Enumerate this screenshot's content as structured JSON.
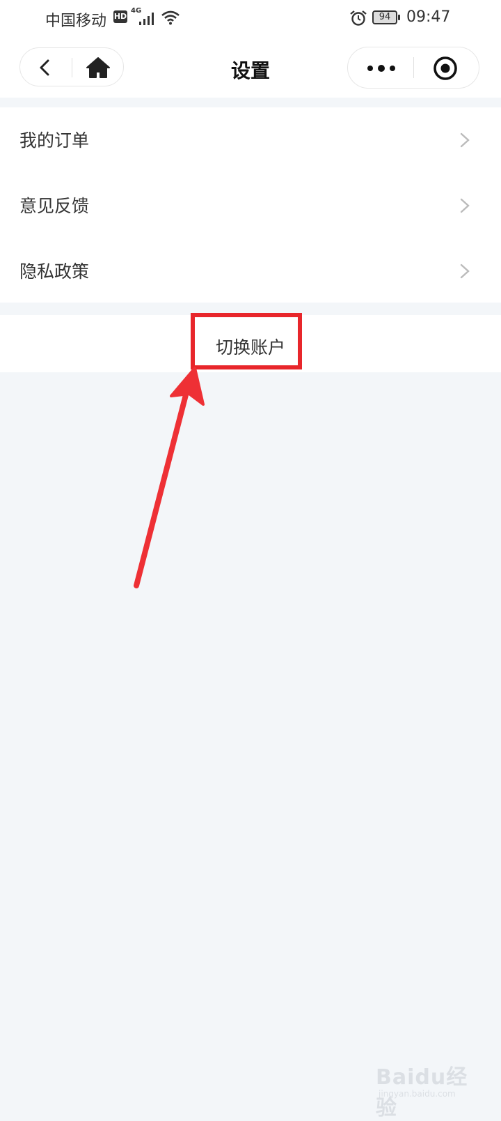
{
  "status_bar": {
    "carrier": "中国移动",
    "hd_badge": "HD",
    "network": "4G",
    "battery": "94",
    "time": "09:47"
  },
  "nav": {
    "title": "设置"
  },
  "menu": {
    "items": [
      {
        "label": "我的订单"
      },
      {
        "label": "意见反馈"
      },
      {
        "label": "隐私政策"
      }
    ]
  },
  "switch_account": {
    "label": "切换账户"
  },
  "watermark": {
    "brand": "Baidu经验",
    "url": "jingyan.baidu.com"
  },
  "colors": {
    "background": "#f3f6f9",
    "surface": "#ffffff",
    "highlight": "#e8262b",
    "text": "#333333"
  },
  "icons": [
    "back-icon",
    "home-icon",
    "more-icon",
    "target-icon",
    "chevron-right-icon",
    "alarm-icon",
    "wifi-icon",
    "signal-icon",
    "battery-icon"
  ]
}
